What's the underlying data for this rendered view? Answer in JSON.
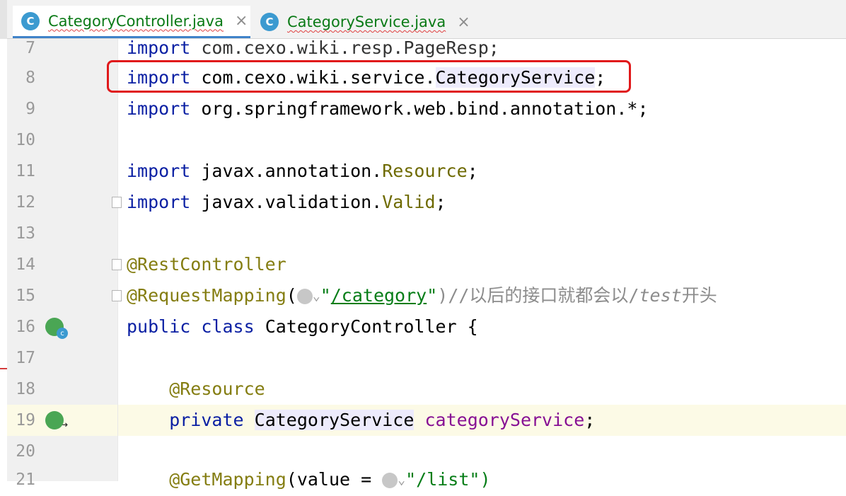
{
  "tabs": [
    {
      "label": "CategoryController.java",
      "icon": "C",
      "active": true
    },
    {
      "label": "CategoryService.java",
      "icon": "C",
      "active": false
    }
  ],
  "close_glyph": "×",
  "lines": {
    "l7": {
      "num": "7",
      "p1": "import",
      "p2": " com.cexo.wiki.resp.PageResp;"
    },
    "l8": {
      "num": "8",
      "p1": "import",
      "p2": " com.cexo.wiki.service.",
      "p3": "CategoryService",
      "p4": ";"
    },
    "l9": {
      "num": "9",
      "p1": "import",
      "p2": " org.springframework.web.bind.annotation.*;"
    },
    "l10": {
      "num": "10"
    },
    "l11": {
      "num": "11",
      "p1": "import",
      "p2": " javax.annotation.",
      "p3": "Resource",
      "p4": ";"
    },
    "l12": {
      "num": "12",
      "p1": "import",
      "p2": " javax.validation.",
      "p3": "Valid",
      "p4": ";"
    },
    "l13": {
      "num": "13"
    },
    "l14": {
      "num": "14",
      "p1": "@RestController"
    },
    "l15": {
      "num": "15",
      "p1": "@RequestMapping",
      "p2": "(",
      "p3": "\"",
      "p4": "/category",
      "p5": "\"",
      "p6": ")//以后的接口就都会以/",
      "p7": "test",
      "p8": "开头"
    },
    "l16": {
      "num": "16",
      "p1": "public",
      "p2": " ",
      "p3": "class",
      "p4": " CategoryController {"
    },
    "l17": {
      "num": "17"
    },
    "l18": {
      "num": "18",
      "p1": "    @Resource"
    },
    "l19": {
      "num": "19",
      "p1": "    private",
      "p2": " ",
      "p3": "CategoryService",
      "p4": " ",
      "p5": "categoryService",
      "p6": ";"
    },
    "l20": {
      "num": "20"
    },
    "l21": {
      "num": "21",
      "p1": "    @GetMapping",
      "p2": "(value = ",
      "p3": "\"/list\")"
    }
  },
  "colors": {
    "keyword": "#0a1fa3",
    "annotation": "#847d11",
    "string": "#067d17",
    "field": "#871094",
    "highlight_box": "#e0191b",
    "tab_text": "#0a7a16"
  }
}
